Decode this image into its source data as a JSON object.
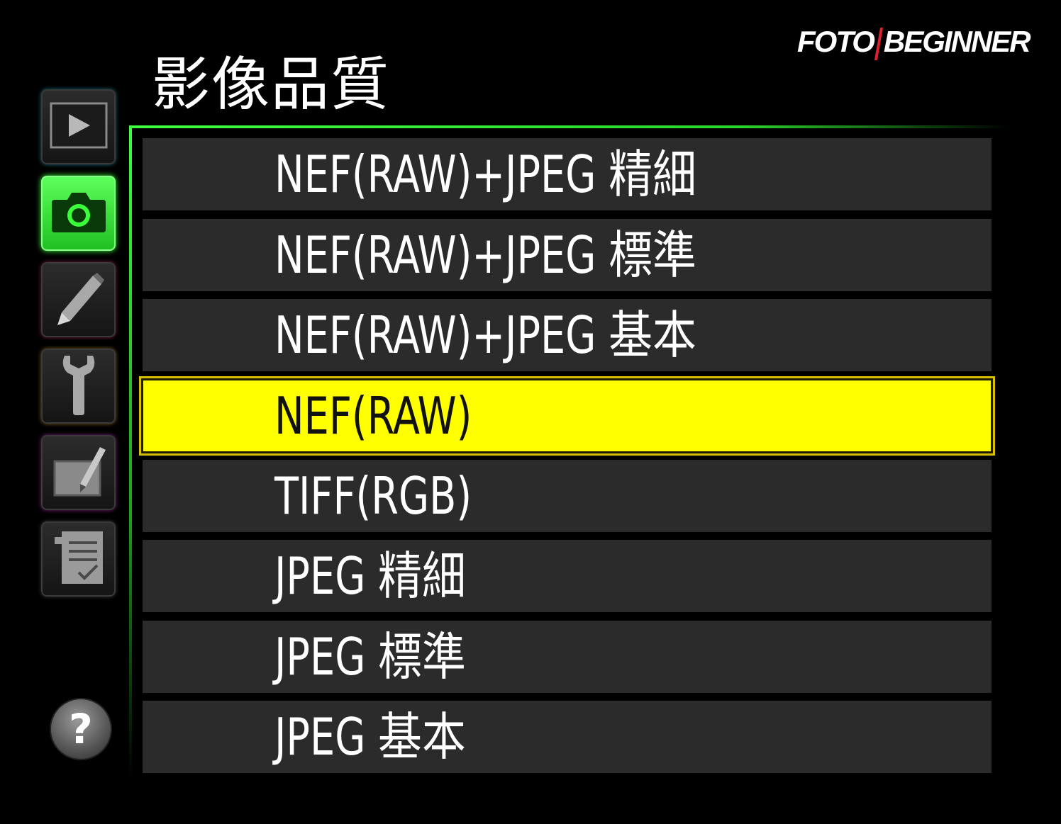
{
  "watermark": {
    "left": "FOTO",
    "right": "BEGINNER"
  },
  "menu": {
    "title": "影像品質"
  },
  "sidebar": {
    "items": [
      {
        "name": "playback-menu",
        "icon": "play-icon"
      },
      {
        "name": "shooting-menu",
        "icon": "camera-icon",
        "active": true,
        "color": "#3cff3c"
      },
      {
        "name": "custom-settings-menu",
        "icon": "pencil-icon"
      },
      {
        "name": "setup-menu",
        "icon": "wrench-icon"
      },
      {
        "name": "retouch-menu",
        "icon": "retouch-brush-icon"
      },
      {
        "name": "recent-settings-menu",
        "icon": "checklist-icon"
      }
    ],
    "help": {
      "icon": "help-icon",
      "glyph": "?"
    }
  },
  "options": [
    {
      "label": "NEF(RAW)+JPEG 精細"
    },
    {
      "label": "NEF(RAW)+JPEG 標準"
    },
    {
      "label": "NEF(RAW)+JPEG 基本"
    },
    {
      "label": "NEF(RAW)",
      "selected": true
    },
    {
      "label": "TIFF(RGB)"
    },
    {
      "label": "JPEG 精細"
    },
    {
      "label": "JPEG 標準"
    },
    {
      "label": "JPEG 基本"
    }
  ],
  "colors": {
    "accent": "#3cff3c",
    "highlight": "#ffff00",
    "row_bg": "#2b2b2b",
    "watermark_separator": "#e0202a"
  }
}
